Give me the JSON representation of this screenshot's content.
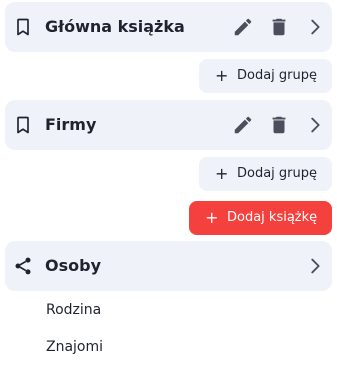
{
  "groups": [
    {
      "title": "Główna książka",
      "icon": "bookmark-icon",
      "add_group_label": "Dodaj grupę"
    },
    {
      "title": "Firmy",
      "icon": "bookmark-icon",
      "add_group_label": "Dodaj grupę"
    }
  ],
  "add_book_label": "Dodaj książkę",
  "shared": {
    "title": "Osoby",
    "icon": "share-icon",
    "items": [
      "Rodzina",
      "Znajomi"
    ]
  },
  "colors": {
    "accent": "#f5413d",
    "card": "#eff2f8",
    "text": "#1f2330",
    "icon": "#4b4f5c"
  }
}
